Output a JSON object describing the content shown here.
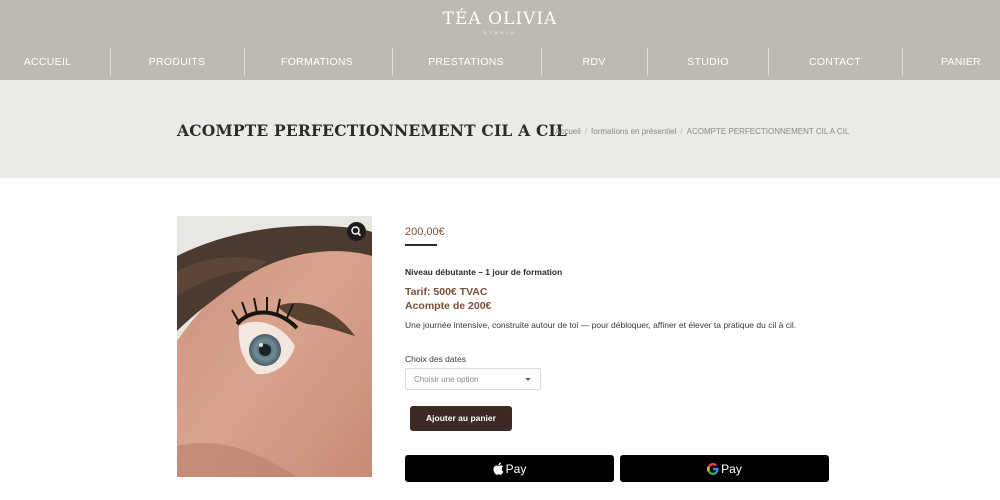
{
  "brand": {
    "name": "TÉA OLIVIA",
    "sub": "STUDIO"
  },
  "nav": {
    "items": [
      {
        "label": "ACCUEIL"
      },
      {
        "label": "PRODUITS"
      },
      {
        "label": "FORMATIONS"
      },
      {
        "label": "PRESTATIONS"
      },
      {
        "label": "RDV"
      },
      {
        "label": "STUDIO"
      },
      {
        "label": "CONTACT"
      },
      {
        "label": "PANIER"
      }
    ]
  },
  "page": {
    "title": "ACOMPTE PERFECTIONNEMENT CIL A CIL",
    "breadcrumb": [
      "Accueil",
      "formations en présentiel",
      "ACOMPTE PERFECTIONNEMENT CIL A CIL"
    ]
  },
  "product": {
    "price": "200,00€",
    "level": "Niveau débutante – 1 jour de formation",
    "tarif": "Tarif: 500€ TVAC",
    "acompte": "Acompte de 200€",
    "description": "Une journée intensive, construite autour de toi — pour débloquer, affiner et élever ta pratique du cil à cil.",
    "dates_label": "Choix des dates",
    "select_placeholder": "Choisir une option",
    "add_to_cart": "Ajouter au panier",
    "apple_pay": "Pay",
    "google_pay": "Pay"
  },
  "colors": {
    "header_bg": "#bdbab1",
    "title_band_bg": "#ebeae5",
    "accent_brown": "#7a4f3a",
    "button_dark": "#3e2a24"
  },
  "icons": [
    "search-icon",
    "apple-icon",
    "google-icon",
    "chevron-down-icon"
  ]
}
